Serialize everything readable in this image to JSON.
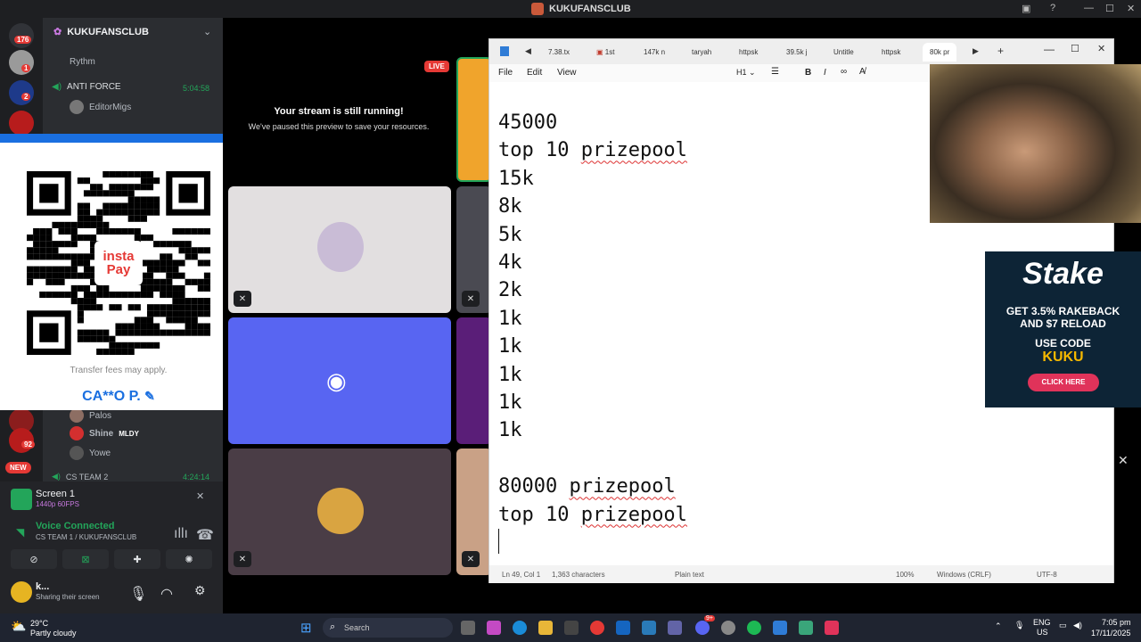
{
  "window": {
    "title": "KUKUFANSCLUB"
  },
  "rail": {
    "badges": [
      "176",
      "1",
      "2",
      "92"
    ],
    "new_label": "NEW"
  },
  "sidebar": {
    "server_name": "KUKUFANSCLUB",
    "members": [
      {
        "name": "Rythm"
      },
      {
        "name": "ANTI FORCE",
        "time": "5:04:58"
      },
      {
        "name": "EditorMigs"
      },
      {
        "name": "Palos"
      },
      {
        "name": "Shine",
        "tag": "MLDY"
      },
      {
        "name": "Yowe"
      },
      {
        "name": "CS TEAM 2",
        "time": "4:24:14"
      }
    ]
  },
  "qr_panel": {
    "logo_top": "insta",
    "logo_bottom": "Pay",
    "fee_note": "Transfer fees may apply.",
    "account_name": "CA**O P."
  },
  "user_panel": {
    "screen_title": "Screen 1",
    "screen_sub": "1440p 60FPS",
    "voice_status": "Voice Connected",
    "voice_channel": "CS TEAM 1 / KUKUFANSCLUB",
    "user_name": "k...",
    "user_status": "Sharing their screen"
  },
  "stage": {
    "live_label": "LIVE",
    "paused_title": "Your stream is still running!",
    "paused_sub": "We've paused this preview to save your resources."
  },
  "notepad": {
    "tabs": [
      "7.38.tx",
      "1st",
      "147k n",
      "taryah",
      "httpsk",
      "39.5k j",
      "Untitle",
      "httpsk",
      "80k pr"
    ],
    "menu": [
      "File",
      "Edit",
      "View"
    ],
    "heading_label": "H1",
    "lines": [
      "45000",
      "top 10 prizepool",
      "15k",
      "8k",
      "5k",
      "4k",
      "2k",
      "1k",
      "1k",
      "1k",
      "1k",
      "1k",
      "",
      "80000 prizepool",
      "top 10 prizepool"
    ],
    "status": {
      "position": "Ln 49, Col 1",
      "chars": "1,363 characters",
      "format": "Plain text",
      "zoom": "100%",
      "line_ending": "Windows (CRLF)",
      "encoding": "UTF-8"
    }
  },
  "stake_ad": {
    "brand": "Stake",
    "line1": "GET 3.5% RAKEBACK",
    "line2": "AND $7 RELOAD",
    "line3": "USE CODE",
    "code": "KUKU",
    "cta": "CLICK HERE"
  },
  "taskbar": {
    "weather_temp": "29°C",
    "weather_desc": "Partly cloudy",
    "search_placeholder": "Search",
    "lang1": "ENG",
    "lang2": "US",
    "time": "7:05 pm",
    "date": "17/11/2025",
    "notification_count": "9+"
  },
  "colors": {
    "discord_bg": "#2b2d31",
    "accent_green": "#23a55a",
    "notepad_bg": "#ffffff",
    "stake_bg": "#0d2436"
  }
}
